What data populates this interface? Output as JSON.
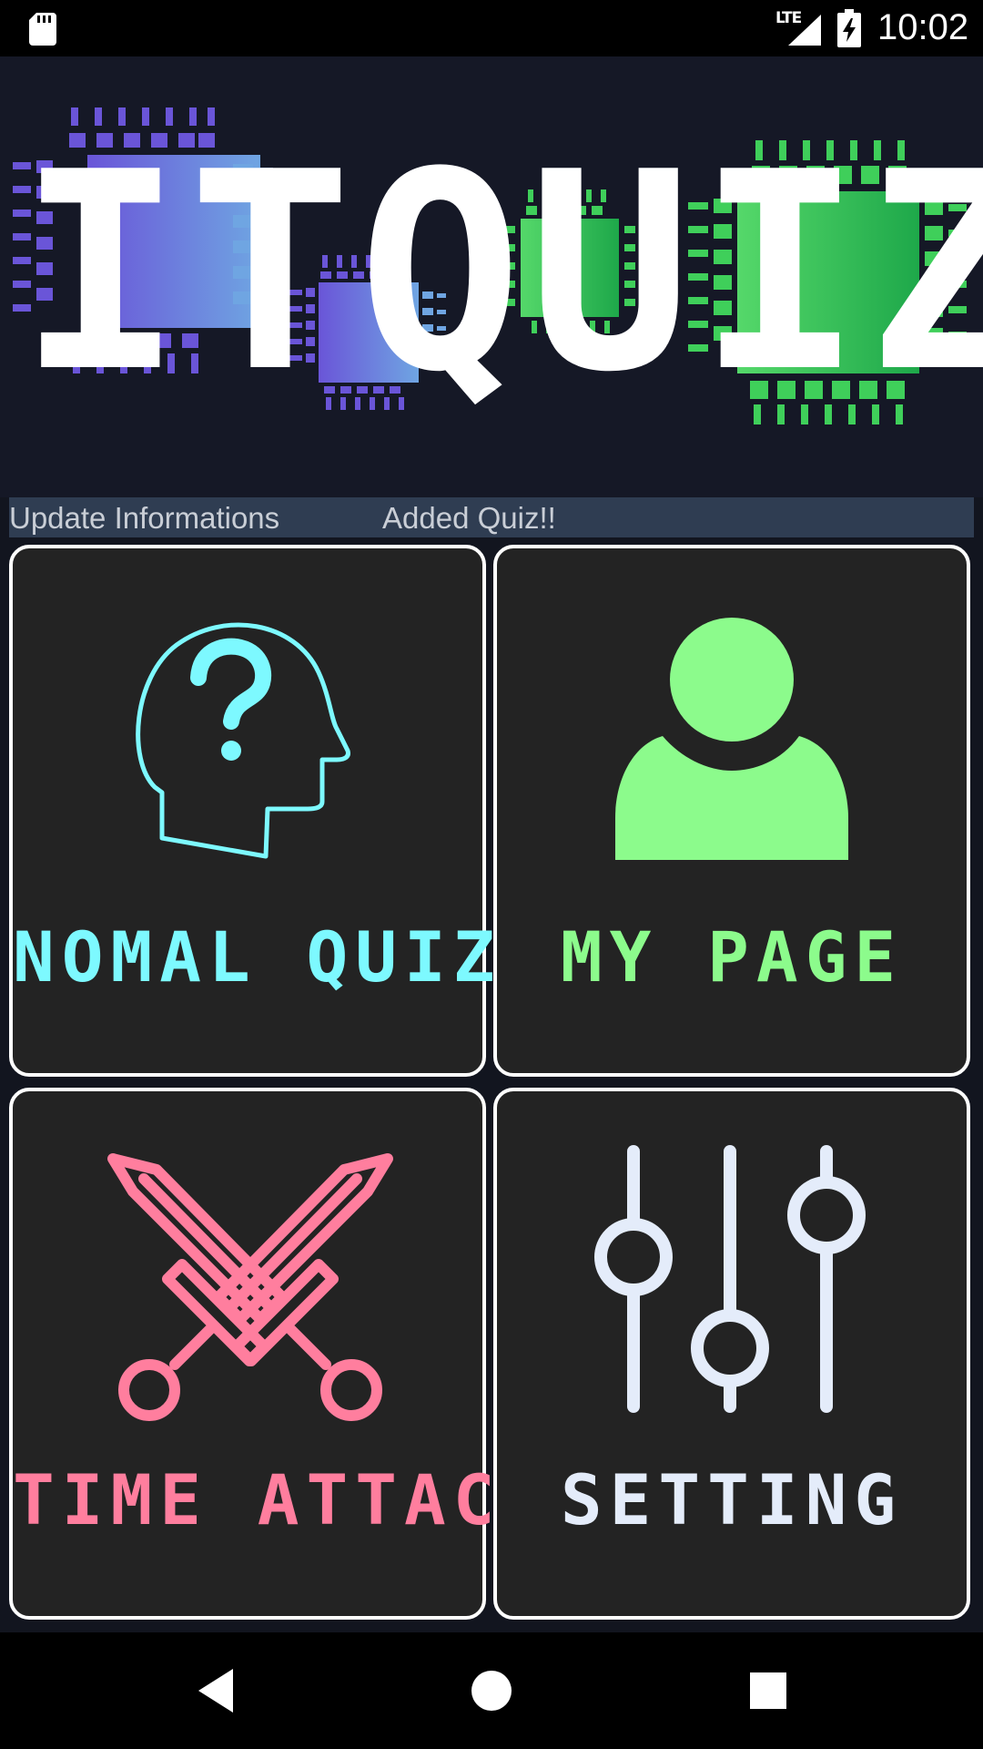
{
  "status_bar": {
    "time": "10:02",
    "network": "LTE",
    "icons": [
      "sd-card-icon",
      "signal-icon",
      "battery-charging-icon"
    ]
  },
  "banner": {
    "title_letters": [
      "I",
      "T",
      " ",
      "Q",
      "U",
      "I",
      "Z"
    ]
  },
  "update_info": {
    "label": "Update Informations",
    "message": "Added Quiz!!"
  },
  "menu": {
    "normal_quiz": {
      "label": "NOMAL QUIZ",
      "icon": "head-question-icon",
      "color": "#7df9ff"
    },
    "my_page": {
      "label": "MY PAGE",
      "icon": "user-icon",
      "color": "#8cfb8c"
    },
    "time_attack": {
      "label": "TIME ATTACK",
      "icon": "crossed-swords-icon",
      "color": "#ff7e9e"
    },
    "setting": {
      "label": "SETTING",
      "icon": "sliders-icon",
      "color": "#e4ecfa"
    }
  },
  "nav": {
    "icons": [
      "back-icon",
      "home-icon",
      "recents-icon"
    ]
  },
  "colors": {
    "background": "#12151f",
    "card_background": "#232323",
    "card_border": "#ffffff",
    "update_bar": "#2f3d52",
    "chip_blue_start": "#6a55d8",
    "chip_blue_end": "#6fa5e2",
    "chip_green_start": "#55d86a",
    "chip_green_end": "#1ea84a"
  }
}
